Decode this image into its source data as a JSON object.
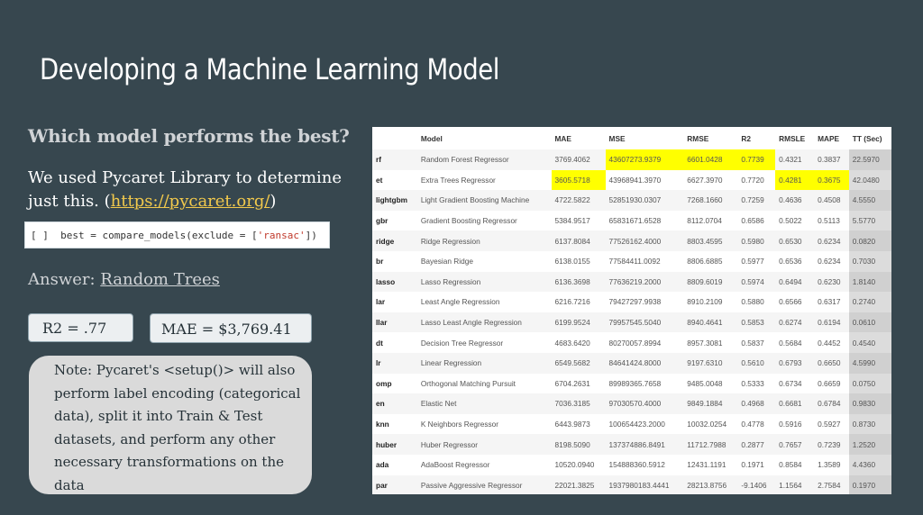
{
  "slide": {
    "title": "Developing a Machine Learning Model",
    "question": "Which model performs the best?",
    "used_text": "We used Pycaret Library to determine just this. (",
    "used_link": "https://pycaret.org/",
    "used_close": ")",
    "code_prompt": "[ ]",
    "code_pre": "best = compare_models(exclude = [",
    "code_str": "'ransac'",
    "code_post": "])",
    "answer_label": "Answer: ",
    "answer_value": "Random Trees",
    "r2_box": "R2 = .77",
    "mae_box": "MAE = $3,769.41",
    "note": "Note: Pycaret's <setup()> will also perform label encoding (categorical data), split it into Train & Test datasets, and perform any other necessary transformations on the data"
  },
  "table": {
    "headers": [
      "",
      "Model",
      "MAE",
      "MSE",
      "RMSE",
      "R2",
      "RMSLE",
      "MAPE",
      "TT (Sec)"
    ],
    "rows": [
      [
        "rf",
        "Random Forest Regressor",
        "3769.4062",
        "43607273.9379",
        "6601.0428",
        "0.7739",
        "0.4321",
        "0.3837",
        "22.5970"
      ],
      [
        "et",
        "Extra Trees Regressor",
        "3605.5718",
        "43968941.3970",
        "6627.3970",
        "0.7720",
        "0.4281",
        "0.3675",
        "42.0480"
      ],
      [
        "lightgbm",
        "Light Gradient Boosting Machine",
        "4722.5822",
        "52851930.0307",
        "7268.1660",
        "0.7259",
        "0.4636",
        "0.4508",
        "4.5550"
      ],
      [
        "gbr",
        "Gradient Boosting Regressor",
        "5384.9517",
        "65831671.6528",
        "8112.0704",
        "0.6586",
        "0.5022",
        "0.5113",
        "5.5770"
      ],
      [
        "ridge",
        "Ridge Regression",
        "6137.8084",
        "77526162.4000",
        "8803.4595",
        "0.5980",
        "0.6530",
        "0.6234",
        "0.0820"
      ],
      [
        "br",
        "Bayesian Ridge",
        "6138.0155",
        "77584411.0092",
        "8806.6885",
        "0.5977",
        "0.6536",
        "0.6234",
        "0.7030"
      ],
      [
        "lasso",
        "Lasso Regression",
        "6136.3698",
        "77636219.2000",
        "8809.6019",
        "0.5974",
        "0.6494",
        "0.6230",
        "1.8140"
      ],
      [
        "lar",
        "Least Angle Regression",
        "6216.7216",
        "79427297.9938",
        "8910.2109",
        "0.5880",
        "0.6566",
        "0.6317",
        "0.2740"
      ],
      [
        "llar",
        "Lasso Least Angle Regression",
        "6199.9524",
        "79957545.5040",
        "8940.4641",
        "0.5853",
        "0.6274",
        "0.6194",
        "0.0610"
      ],
      [
        "dt",
        "Decision Tree Regressor",
        "4683.6420",
        "80270057.8994",
        "8957.3081",
        "0.5837",
        "0.5684",
        "0.4452",
        "0.4540"
      ],
      [
        "lr",
        "Linear Regression",
        "6549.5682",
        "84641424.8000",
        "9197.6310",
        "0.5610",
        "0.6793",
        "0.6650",
        "4.5990"
      ],
      [
        "omp",
        "Orthogonal Matching Pursuit",
        "6704.2631",
        "89989365.7658",
        "9485.0048",
        "0.5333",
        "0.6734",
        "0.6659",
        "0.0750"
      ],
      [
        "en",
        "Elastic Net",
        "7036.3185",
        "97030570.4000",
        "9849.1884",
        "0.4968",
        "0.6681",
        "0.6784",
        "0.9830"
      ],
      [
        "knn",
        "K Neighbors Regressor",
        "6443.9873",
        "100654423.2000",
        "10032.0254",
        "0.4778",
        "0.5916",
        "0.5927",
        "0.8730"
      ],
      [
        "huber",
        "Huber Regressor",
        "8198.5090",
        "137374886.8491",
        "11712.7988",
        "0.2877",
        "0.7657",
        "0.7239",
        "1.2520"
      ],
      [
        "ada",
        "AdaBoost Regressor",
        "10520.0940",
        "154888360.5912",
        "12431.1191",
        "0.1971",
        "0.8584",
        "1.3589",
        "4.4360"
      ],
      [
        "par",
        "Passive Aggressive Regressor",
        "22021.3825",
        "1937980183.4441",
        "28213.8756",
        "-9.1406",
        "1.1564",
        "2.7584",
        "0.1970"
      ]
    ],
    "highlight_color": "#ffff00",
    "highlights": [
      [
        0,
        3
      ],
      [
        0,
        4
      ],
      [
        0,
        5
      ],
      [
        1,
        2
      ],
      [
        1,
        6
      ],
      [
        1,
        7
      ]
    ]
  }
}
